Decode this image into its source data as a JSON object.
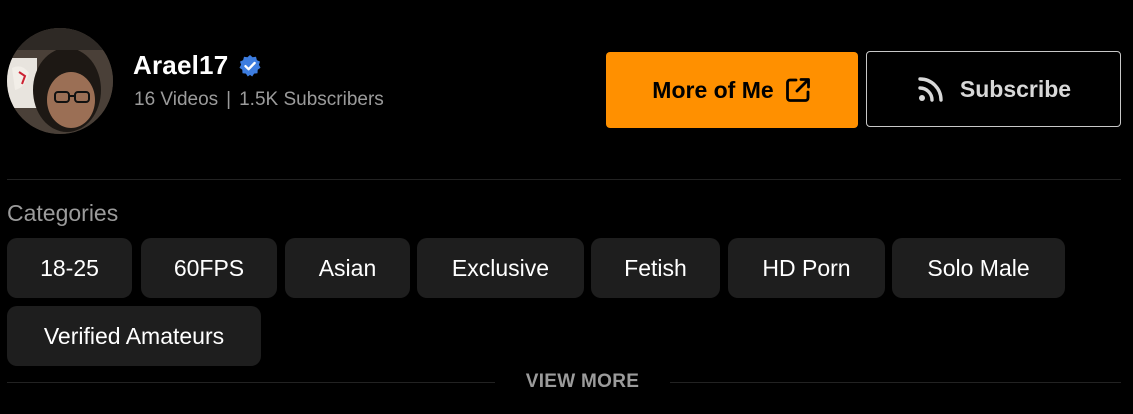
{
  "channel": {
    "name": "Arael17",
    "videos": "16 Videos",
    "separator": "|",
    "subscribers": "1.5K Subscribers"
  },
  "actions": {
    "more_label": "More of Me",
    "subscribe_label": "Subscribe"
  },
  "categories": {
    "heading": "Categories",
    "items": [
      "18-25",
      "60FPS",
      "Asian",
      "Exclusive",
      "Fetish",
      "HD Porn",
      "Solo Male",
      "Verified Amateurs"
    ]
  },
  "view_more_label": "VIEW MORE",
  "colors": {
    "background": "#000000",
    "accent": "#ff9000",
    "pill": "#1e1e1e",
    "muted_text": "#9b9b9b",
    "verified": "#3d7de0"
  },
  "icons": {
    "verified": "verified-check-icon",
    "external": "external-link-icon",
    "rss": "rss-icon"
  }
}
